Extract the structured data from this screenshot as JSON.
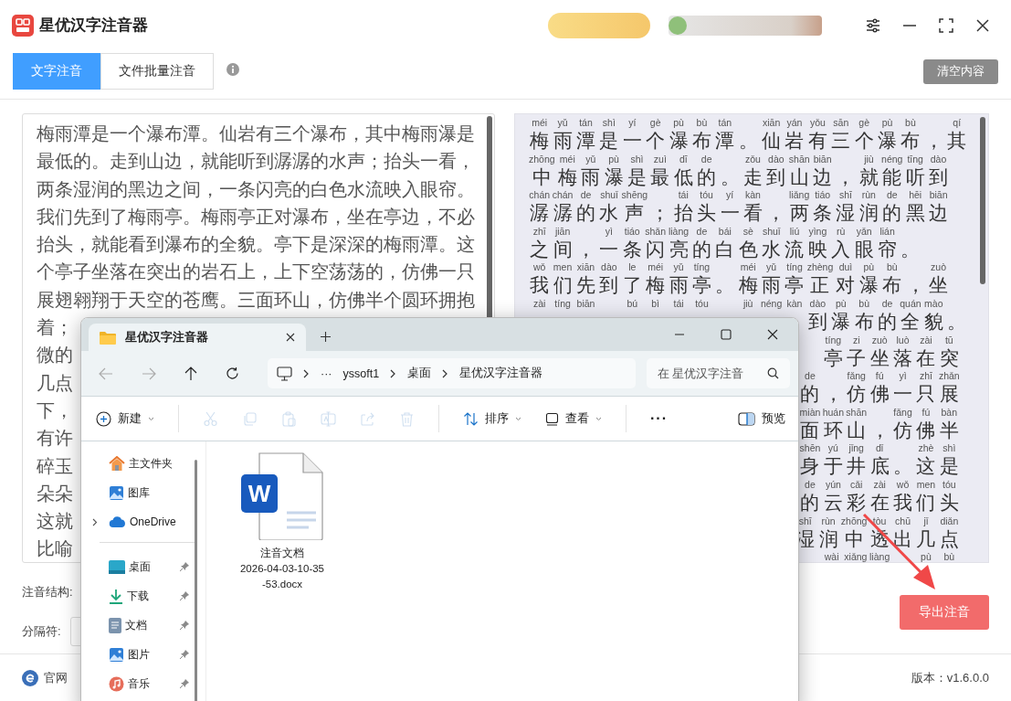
{
  "app": {
    "title": "星优汉字注音器"
  },
  "tabs": [
    {
      "label": "文字注音",
      "selected": true
    },
    {
      "label": "文件批量注音",
      "selected": false
    }
  ],
  "clear_button": "清空内容",
  "source_lines": [
    "梅雨潭是一个瀑布潭。仙岩有三个瀑布，其中梅雨瀑是",
    "最低的。走到山边，就能听到潺潺的水声；抬头一看，",
    "两条湿润的黑边之间，一条闪亮的白色水流映入眼帘。",
    "我们先到了梅雨亭。梅雨亭正对瀑布，坐在亭边，不必",
    "抬头，就能看到瀑布的全貌。亭下是深深的梅雨潭。这",
    "个亭子坐落在突出的岩石上，上下空荡荡的，仿佛一只",
    "展翅翱翔于天空的苍鹰。三面环山，仿佛半个圆环拥抱"
  ],
  "source_cut_lines": [
    "着；",
    "微的",
    "几点",
    "下，",
    "有许",
    "碎玉",
    "朵朵",
    "这就",
    "比喻"
  ],
  "pinyin_rows": [
    {
      "covered": false,
      "cells": [
        {
          "kind": "syllable",
          "py": "méi",
          "ch": "梅"
        },
        {
          "kind": "syllable",
          "py": "yǔ",
          "ch": "雨"
        },
        {
          "kind": "syllable",
          "py": "tán",
          "ch": "潭"
        },
        {
          "kind": "syllable",
          "py": "shì",
          "ch": "是"
        },
        {
          "kind": "syllable",
          "py": "yí",
          "ch": "一"
        },
        {
          "kind": "syllable",
          "py": "gè",
          "ch": "个"
        },
        {
          "kind": "syllable",
          "py": "pù",
          "ch": "瀑"
        },
        {
          "kind": "syllable",
          "py": "bù",
          "ch": "布"
        },
        {
          "kind": "syllable",
          "py": "tán",
          "ch": "潭"
        },
        {
          "kind": "punct",
          "ch": "。"
        },
        {
          "kind": "syllable",
          "py": "xiān",
          "ch": "仙"
        },
        {
          "kind": "syllable",
          "py": "yán",
          "ch": "岩"
        },
        {
          "kind": "syllable",
          "py": "yǒu",
          "ch": "有"
        },
        {
          "kind": "syllable",
          "py": "sān",
          "ch": "三"
        },
        {
          "kind": "syllable",
          "py": "gè",
          "ch": "个"
        },
        {
          "kind": "syllable",
          "py": "pù",
          "ch": "瀑"
        },
        {
          "kind": "syllable",
          "py": "bù",
          "ch": "布"
        },
        {
          "kind": "punct",
          "ch": "，"
        },
        {
          "kind": "syllable",
          "py": "qí",
          "ch": "其"
        }
      ]
    },
    {
      "covered": false,
      "cells": [
        {
          "kind": "syllable",
          "py": "zhōng",
          "ch": "中"
        },
        {
          "kind": "syllable",
          "py": "méi",
          "ch": "梅"
        },
        {
          "kind": "syllable",
          "py": "yǔ",
          "ch": "雨"
        },
        {
          "kind": "syllable",
          "py": "pù",
          "ch": "瀑"
        },
        {
          "kind": "syllable",
          "py": "shì",
          "ch": "是"
        },
        {
          "kind": "syllable",
          "py": "zuì",
          "ch": "最"
        },
        {
          "kind": "syllable",
          "py": "dī",
          "ch": "低"
        },
        {
          "kind": "syllable",
          "py": "de",
          "ch": "的"
        },
        {
          "kind": "punct",
          "ch": "。"
        },
        {
          "kind": "syllable",
          "py": "zǒu",
          "ch": "走"
        },
        {
          "kind": "syllable",
          "py": "dào",
          "ch": "到"
        },
        {
          "kind": "syllable",
          "py": "shān",
          "ch": "山"
        },
        {
          "kind": "syllable",
          "py": "biān",
          "ch": "边"
        },
        {
          "kind": "punct",
          "ch": "，"
        },
        {
          "kind": "syllable",
          "py": "jiù",
          "ch": "就"
        },
        {
          "kind": "syllable",
          "py": "néng",
          "ch": "能"
        },
        {
          "kind": "syllable",
          "py": "tīng",
          "ch": "听"
        },
        {
          "kind": "syllable",
          "py": "dào",
          "ch": "到"
        }
      ]
    },
    {
      "covered": false,
      "cells": [
        {
          "kind": "syllable",
          "py": "chán",
          "ch": "潺"
        },
        {
          "kind": "syllable",
          "py": "chán",
          "ch": "潺"
        },
        {
          "kind": "syllable",
          "py": "de",
          "ch": "的"
        },
        {
          "kind": "syllable",
          "py": "shuǐ",
          "ch": "水"
        },
        {
          "kind": "syllable",
          "py": "shēng",
          "ch": "声"
        },
        {
          "kind": "punct",
          "ch": "；"
        },
        {
          "kind": "syllable",
          "py": "tái",
          "ch": "抬"
        },
        {
          "kind": "syllable",
          "py": "tóu",
          "ch": "头"
        },
        {
          "kind": "syllable",
          "py": "yí",
          "ch": "一"
        },
        {
          "kind": "syllable",
          "py": "kàn",
          "ch": "看"
        },
        {
          "kind": "punct",
          "ch": "，"
        },
        {
          "kind": "syllable",
          "py": "liǎng",
          "ch": "两"
        },
        {
          "kind": "syllable",
          "py": "tiáo",
          "ch": "条"
        },
        {
          "kind": "syllable",
          "py": "shī",
          "ch": "湿"
        },
        {
          "kind": "syllable",
          "py": "rùn",
          "ch": "润"
        },
        {
          "kind": "syllable",
          "py": "de",
          "ch": "的"
        },
        {
          "kind": "syllable",
          "py": "hēi",
          "ch": "黑"
        },
        {
          "kind": "syllable",
          "py": "biān",
          "ch": "边"
        }
      ]
    },
    {
      "covered": false,
      "cells": [
        {
          "kind": "syllable",
          "py": "zhī",
          "ch": "之"
        },
        {
          "kind": "syllable",
          "py": "jiān",
          "ch": "间"
        },
        {
          "kind": "punct",
          "ch": "，"
        },
        {
          "kind": "syllable",
          "py": "yì",
          "ch": "一"
        },
        {
          "kind": "syllable",
          "py": "tiáo",
          "ch": "条"
        },
        {
          "kind": "syllable",
          "py": "shǎn",
          "ch": "闪"
        },
        {
          "kind": "syllable",
          "py": "liàng",
          "ch": "亮"
        },
        {
          "kind": "syllable",
          "py": "de",
          "ch": "的"
        },
        {
          "kind": "syllable",
          "py": "bái",
          "ch": "白"
        },
        {
          "kind": "syllable",
          "py": "sè",
          "ch": "色"
        },
        {
          "kind": "syllable",
          "py": "shuǐ",
          "ch": "水"
        },
        {
          "kind": "syllable",
          "py": "liú",
          "ch": "流"
        },
        {
          "kind": "syllable",
          "py": "yìng",
          "ch": "映"
        },
        {
          "kind": "syllable",
          "py": "rù",
          "ch": "入"
        },
        {
          "kind": "syllable",
          "py": "yǎn",
          "ch": "眼"
        },
        {
          "kind": "syllable",
          "py": "lián",
          "ch": "帘"
        },
        {
          "kind": "punct",
          "ch": "。"
        }
      ]
    },
    {
      "covered": false,
      "cells": [
        {
          "kind": "syllable",
          "py": "wǒ",
          "ch": "我"
        },
        {
          "kind": "syllable",
          "py": "men",
          "ch": "们"
        },
        {
          "kind": "syllable",
          "py": "xiān",
          "ch": "先"
        },
        {
          "kind": "syllable",
          "py": "dào",
          "ch": "到"
        },
        {
          "kind": "syllable",
          "py": "le",
          "ch": "了"
        },
        {
          "kind": "syllable",
          "py": "méi",
          "ch": "梅"
        },
        {
          "kind": "syllable",
          "py": "yǔ",
          "ch": "雨"
        },
        {
          "kind": "syllable",
          "py": "tíng",
          "ch": "亭"
        },
        {
          "kind": "punct",
          "ch": "。"
        },
        {
          "kind": "syllable",
          "py": "méi",
          "ch": "梅"
        },
        {
          "kind": "syllable",
          "py": "yǔ",
          "ch": "雨"
        },
        {
          "kind": "syllable",
          "py": "tíng",
          "ch": "亭"
        },
        {
          "kind": "syllable",
          "py": "zhèng",
          "ch": "正"
        },
        {
          "kind": "syllable",
          "py": "duì",
          "ch": "对"
        },
        {
          "kind": "syllable",
          "py": "pù",
          "ch": "瀑"
        },
        {
          "kind": "syllable",
          "py": "bù",
          "ch": "布"
        },
        {
          "kind": "punct",
          "ch": "，"
        },
        {
          "kind": "syllable",
          "py": "zuò",
          "ch": "坐"
        }
      ]
    },
    {
      "covered": false,
      "cells": [
        {
          "kind": "syllable",
          "py": "zài"
        },
        {
          "kind": "syllable",
          "py": "tíng"
        },
        {
          "kind": "syllable",
          "py": "biān"
        },
        {
          "kind": "punct"
        },
        {
          "kind": "syllable",
          "py": "bú"
        },
        {
          "kind": "syllable",
          "py": "bì"
        },
        {
          "kind": "syllable",
          "py": "tái"
        },
        {
          "kind": "syllable",
          "py": "tóu"
        },
        {
          "kind": "punct"
        },
        {
          "kind": "syllable",
          "py": "jiù"
        },
        {
          "kind": "syllable",
          "py": "néng"
        },
        {
          "kind": "syllable",
          "py": "kàn"
        },
        {
          "kind": "syllable",
          "py": "dào",
          "ch": "到"
        },
        {
          "kind": "syllable",
          "py": "pù",
          "ch": "瀑"
        },
        {
          "kind": "syllable",
          "py": "bù",
          "ch": "布"
        },
        {
          "kind": "syllable",
          "py": "de",
          "ch": "的"
        },
        {
          "kind": "syllable",
          "py": "quán",
          "ch": "全"
        },
        {
          "kind": "syllable",
          "py": "mào",
          "ch": "貌"
        },
        {
          "kind": "punct",
          "ch": "。"
        }
      ]
    },
    {
      "covered": true,
      "cells": [
        {
          "kind": "syllable",
          "py": "tíng",
          "ch": "亭"
        },
        {
          "kind": "syllable",
          "py": "zi",
          "ch": "子"
        },
        {
          "kind": "syllable",
          "py": "zuò",
          "ch": "坐"
        },
        {
          "kind": "syllable",
          "py": "luò",
          "ch": "落"
        },
        {
          "kind": "syllable",
          "py": "zài",
          "ch": "在"
        },
        {
          "kind": "syllable",
          "py": "tū",
          "ch": "突"
        }
      ]
    },
    {
      "covered": true,
      "cells": [
        {
          "kind": "syllable",
          "py": "de",
          "ch": "的"
        },
        {
          "kind": "punct",
          "ch": "，"
        },
        {
          "kind": "syllable",
          "py": "fǎng",
          "ch": "仿"
        },
        {
          "kind": "syllable",
          "py": "fú",
          "ch": "佛"
        },
        {
          "kind": "syllable",
          "py": "yì",
          "ch": "一"
        },
        {
          "kind": "syllable",
          "py": "zhī",
          "ch": "只"
        },
        {
          "kind": "syllable",
          "py": "zhǎn",
          "ch": "展"
        }
      ]
    },
    {
      "covered": true,
      "cells": [
        {
          "kind": "syllable",
          "py": "miàn",
          "ch": "面"
        },
        {
          "kind": "syllable",
          "py": "huán",
          "ch": "环"
        },
        {
          "kind": "syllable",
          "py": "shān",
          "ch": "山"
        },
        {
          "kind": "punct",
          "ch": "，"
        },
        {
          "kind": "syllable",
          "py": "fǎng",
          "ch": "仿"
        },
        {
          "kind": "syllable",
          "py": "fú",
          "ch": "佛"
        },
        {
          "kind": "syllable",
          "py": "bàn",
          "ch": "半"
        }
      ]
    },
    {
      "covered": true,
      "cells": [
        {
          "kind": "syllable",
          "py": "shēn",
          "ch": "身"
        },
        {
          "kind": "syllable",
          "py": "yú",
          "ch": "于"
        },
        {
          "kind": "syllable",
          "py": "jǐng",
          "ch": "井"
        },
        {
          "kind": "syllable",
          "py": "dǐ",
          "ch": "底"
        },
        {
          "kind": "punct",
          "ch": "。"
        },
        {
          "kind": "syllable",
          "py": "zhè",
          "ch": "这"
        },
        {
          "kind": "syllable",
          "py": "shì",
          "ch": "是"
        }
      ]
    },
    {
      "covered": true,
      "cells": [
        {
          "kind": "syllable",
          "py": "de",
          "ch": "的"
        },
        {
          "kind": "syllable",
          "py": "yún",
          "ch": "云"
        },
        {
          "kind": "syllable",
          "py": "cǎi",
          "ch": "彩"
        },
        {
          "kind": "syllable",
          "py": "zài",
          "ch": "在"
        },
        {
          "kind": "syllable",
          "py": "wǒ",
          "ch": "我"
        },
        {
          "kind": "syllable",
          "py": "men",
          "ch": "们"
        },
        {
          "kind": "syllable",
          "py": "tóu",
          "ch": "头"
        }
      ]
    },
    {
      "covered": true,
      "cells": [
        {
          "kind": "syllable",
          "py": "shī",
          "ch": "湿"
        },
        {
          "kind": "syllable",
          "py": "rùn",
          "ch": "润"
        },
        {
          "kind": "syllable",
          "py": "zhōng",
          "ch": "中"
        },
        {
          "kind": "syllable",
          "py": "tòu",
          "ch": "透"
        },
        {
          "kind": "syllable",
          "py": "chū",
          "ch": "出"
        },
        {
          "kind": "syllable",
          "py": "jǐ",
          "ch": "几"
        },
        {
          "kind": "syllable",
          "py": "diǎn",
          "ch": "点"
        }
      ]
    },
    {
      "covered": true,
      "cells": [
        {
          "kind": "syllable",
          "py": "wài"
        },
        {
          "kind": "syllable",
          "py": "xiǎng"
        },
        {
          "kind": "syllable",
          "py": "liàng"
        },
        {
          "kind": "punct"
        },
        {
          "kind": "syllable",
          "py": "pù"
        },
        {
          "kind": "syllable",
          "py": "bù"
        }
      ]
    }
  ],
  "options": [
    {
      "label": "注音结构:"
    },
    {
      "label": "分隔符:"
    }
  ],
  "export_button": "导出注音",
  "footer": {
    "website": "官网",
    "version": "版本：v1.6.0.0"
  },
  "explorer": {
    "tab_title": "星优汉字注音器",
    "path_overflow": "···",
    "path": [
      "yssoft1",
      "桌面",
      "星优汉字注音器"
    ],
    "search_placeholder": "在 星优汉字注音",
    "toolbar": [
      {
        "kind": "new",
        "label": "新建",
        "disabled": false
      },
      {
        "kind": "cut",
        "disabled": true
      },
      {
        "kind": "copy",
        "disabled": true
      },
      {
        "kind": "paste",
        "disabled": true
      },
      {
        "kind": "rename",
        "disabled": true
      },
      {
        "kind": "share",
        "disabled": true
      },
      {
        "kind": "delete",
        "disabled": true
      },
      {
        "kind": "sort",
        "label": "排序",
        "disabled": false
      },
      {
        "kind": "view",
        "label": "查看",
        "disabled": false
      },
      {
        "kind": "more",
        "label": "···",
        "disabled": false
      },
      {
        "kind": "preview",
        "label": "预览",
        "disabled": false
      }
    ],
    "sidebar_groups": [
      [
        {
          "label": "主文件夹",
          "pinned": false,
          "expandable": false
        },
        {
          "label": "图库",
          "pinned": false,
          "expandable": false
        },
        {
          "label": "OneDrive",
          "pinned": false,
          "expandable": true
        }
      ],
      [
        {
          "label": "桌面",
          "pinned": true,
          "expandable": false
        },
        {
          "label": "下载",
          "pinned": true,
          "expandable": false
        },
        {
          "label": "文档",
          "pinned": true,
          "expandable": false
        },
        {
          "label": "图片",
          "pinned": true,
          "expandable": false
        },
        {
          "label": "音乐",
          "pinned": true,
          "expandable": false
        }
      ]
    ],
    "files": [
      {
        "badge": "W",
        "name_lines": [
          "注音文档",
          "2026-04-03-10-35",
          "-53.docx"
        ]
      }
    ]
  }
}
